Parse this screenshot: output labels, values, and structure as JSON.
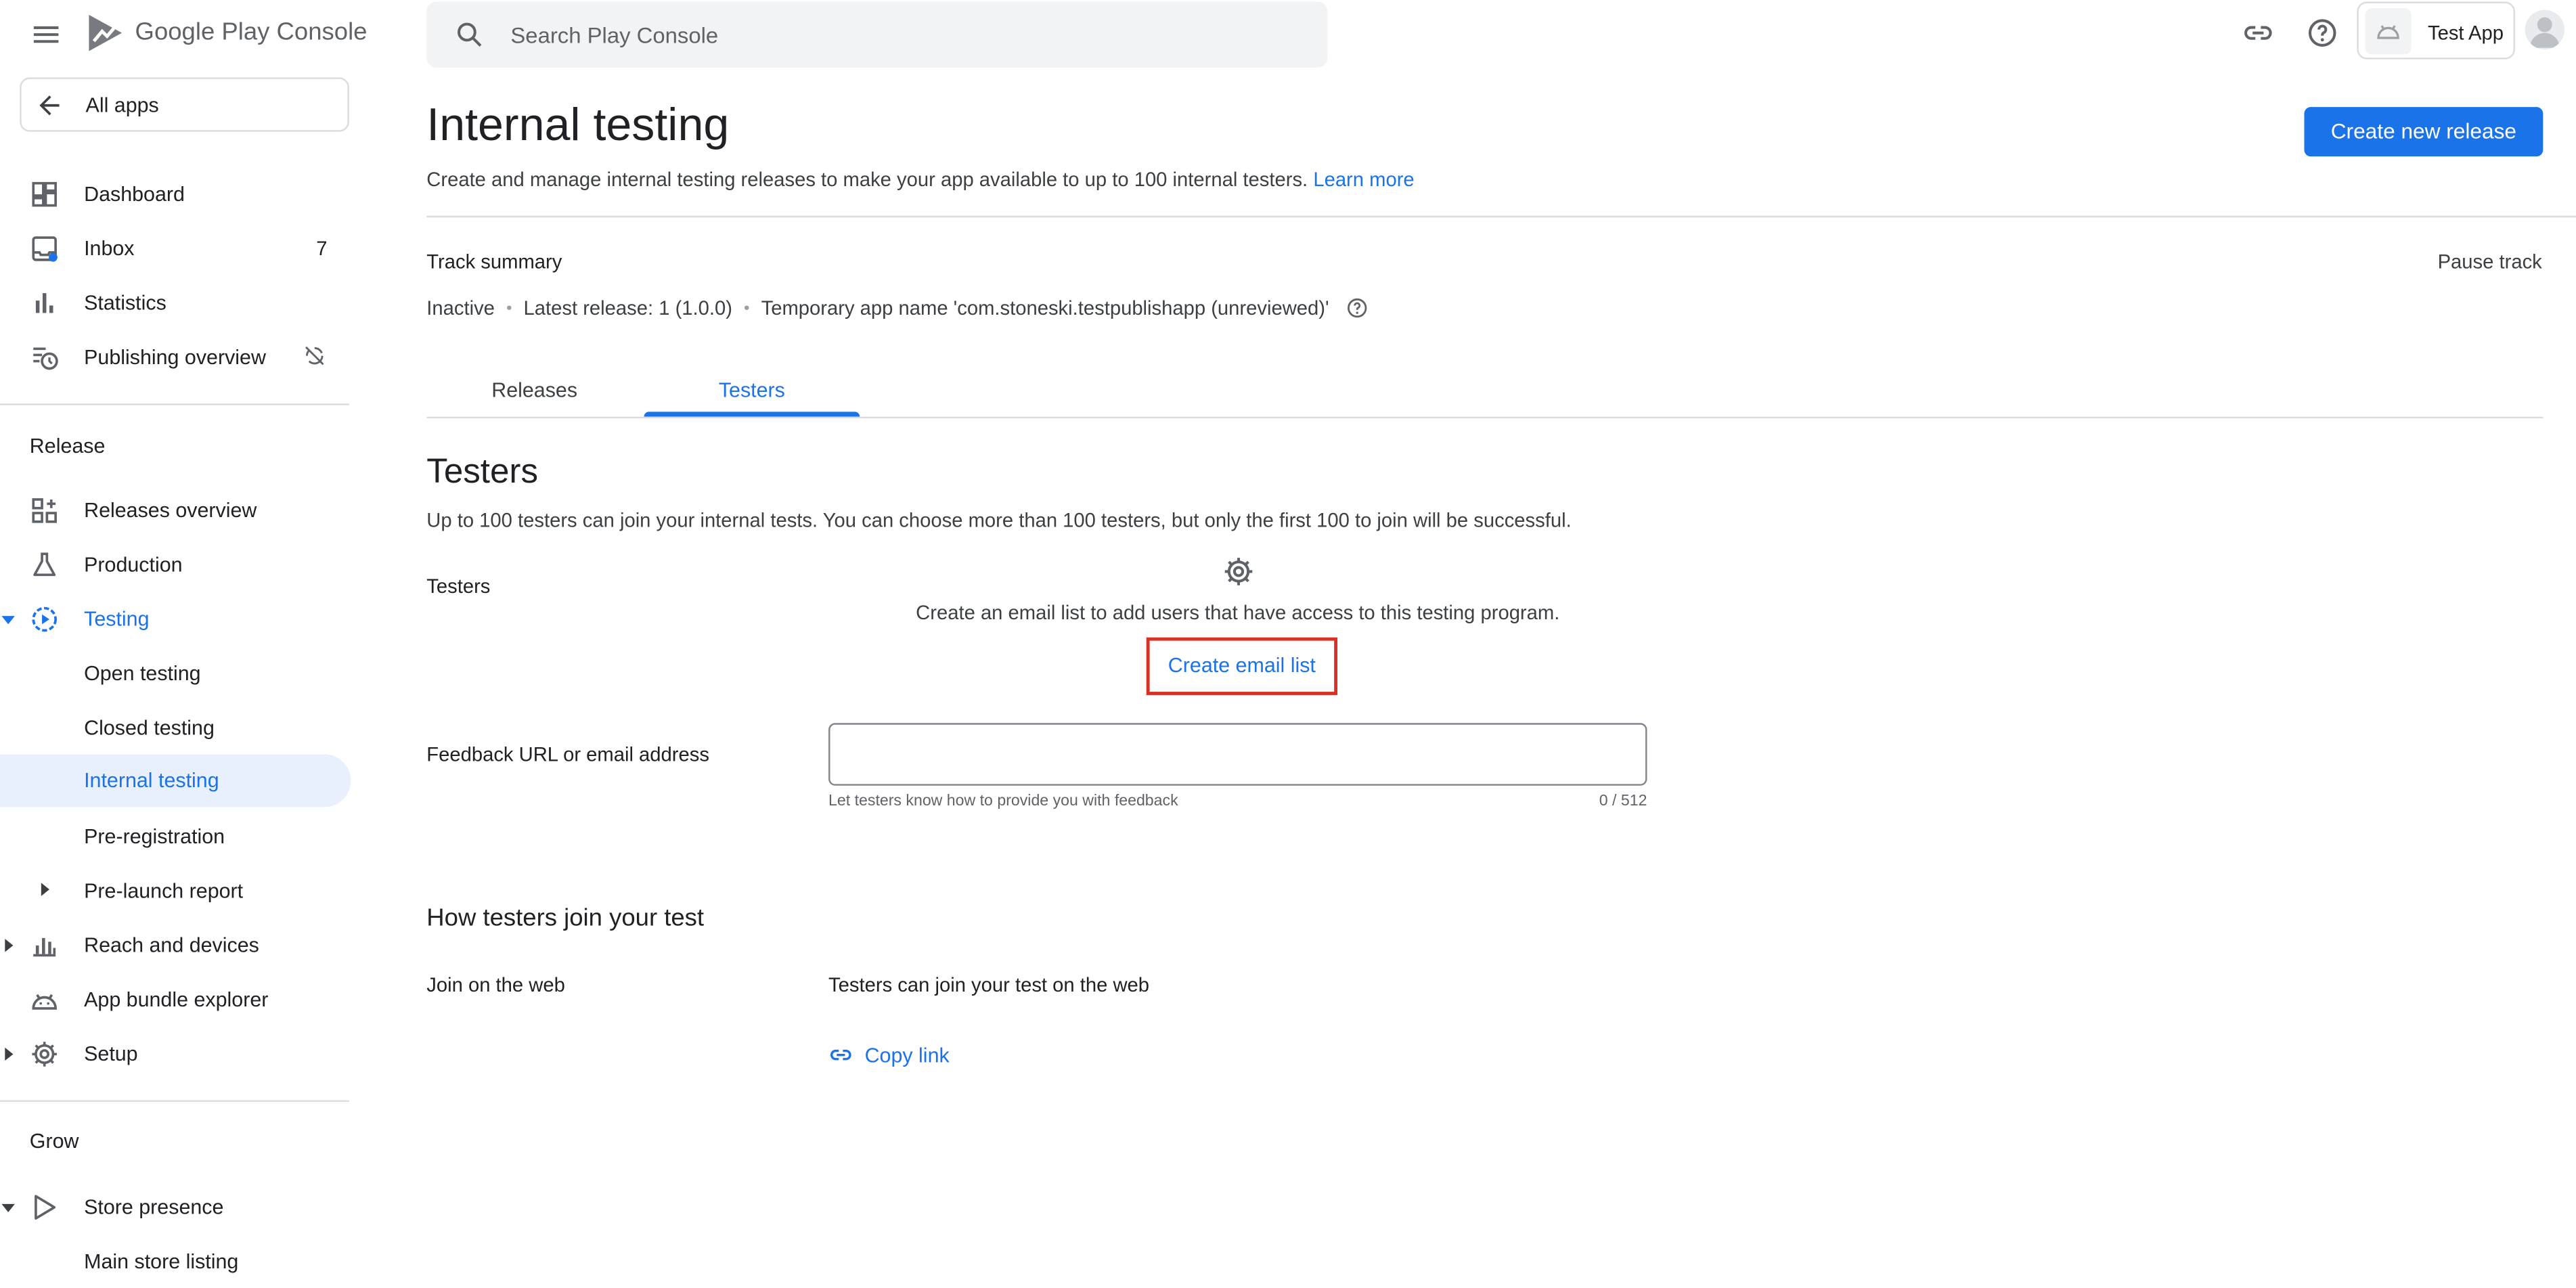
{
  "app": {
    "brand_google": "Google Play",
    "brand_console": "Console"
  },
  "search": {
    "placeholder": "Search Play Console"
  },
  "topbar": {
    "app_chip_label": "Test App"
  },
  "sidebar": {
    "all_apps": "All apps",
    "items": [
      {
        "label": "Dashboard",
        "icon": "dashboard-icon"
      },
      {
        "label": "Inbox",
        "icon": "inbox-icon",
        "badge": "7"
      },
      {
        "label": "Statistics",
        "icon": "bar-chart-icon"
      },
      {
        "label": "Publishing overview",
        "icon": "schedule-icon"
      }
    ],
    "release_section": "Release",
    "release_items": [
      {
        "label": "Releases overview",
        "icon": "grid-plus-icon"
      },
      {
        "label": "Production",
        "icon": "flask-icon"
      },
      {
        "label": "Testing",
        "icon": "play-circle-icon"
      },
      {
        "label": "Open testing"
      },
      {
        "label": "Closed testing"
      },
      {
        "label": "Internal testing"
      },
      {
        "label": "Pre-registration"
      },
      {
        "label": "Pre-launch report"
      },
      {
        "label": "Reach and devices",
        "icon": "bar-chart-icon"
      },
      {
        "label": "App bundle explorer",
        "icon": "android-icon"
      },
      {
        "label": "Setup",
        "icon": "gear-icon"
      }
    ],
    "grow_section": "Grow",
    "grow_items": [
      {
        "label": "Store presence",
        "icon": "play-outline-icon"
      },
      {
        "label": "Main store listing"
      }
    ]
  },
  "page": {
    "title": "Internal testing",
    "create_button": "Create new release",
    "subtitle": "Create and manage internal testing releases to make your app available to up to 100 internal testers.",
    "learn_more": "Learn more",
    "track_summary": "Track summary",
    "pause_track": "Pause track",
    "status": "Inactive",
    "latest_release": "Latest release: 1 (1.0.0)",
    "temp_name": "Temporary app name 'com.stoneski.testpublishapp (unreviewed)'",
    "tabs": [
      {
        "label": "Releases"
      },
      {
        "label": "Testers",
        "active": true
      }
    ]
  },
  "testers": {
    "heading": "Testers",
    "description": "Up to 100 testers can join your internal tests. You can choose more than 100 testers, but only the first 100 to join will be successful.",
    "label": "Testers",
    "empty_message": "Create an email list to add users that have access to this testing program.",
    "create_email_list": "Create email list",
    "feedback_label": "Feedback URL or email address",
    "feedback_value": "",
    "feedback_help": "Let testers know how to provide you with feedback",
    "feedback_count": "0 / 512"
  },
  "join": {
    "heading": "How testers join your test",
    "label": "Join on the web",
    "value": "Testers can join your test on the web",
    "copy_link": "Copy link"
  },
  "colors": {
    "accent": "#1a73e8",
    "highlight_border": "#d93025",
    "selected_bg": "#e8f0fe"
  }
}
